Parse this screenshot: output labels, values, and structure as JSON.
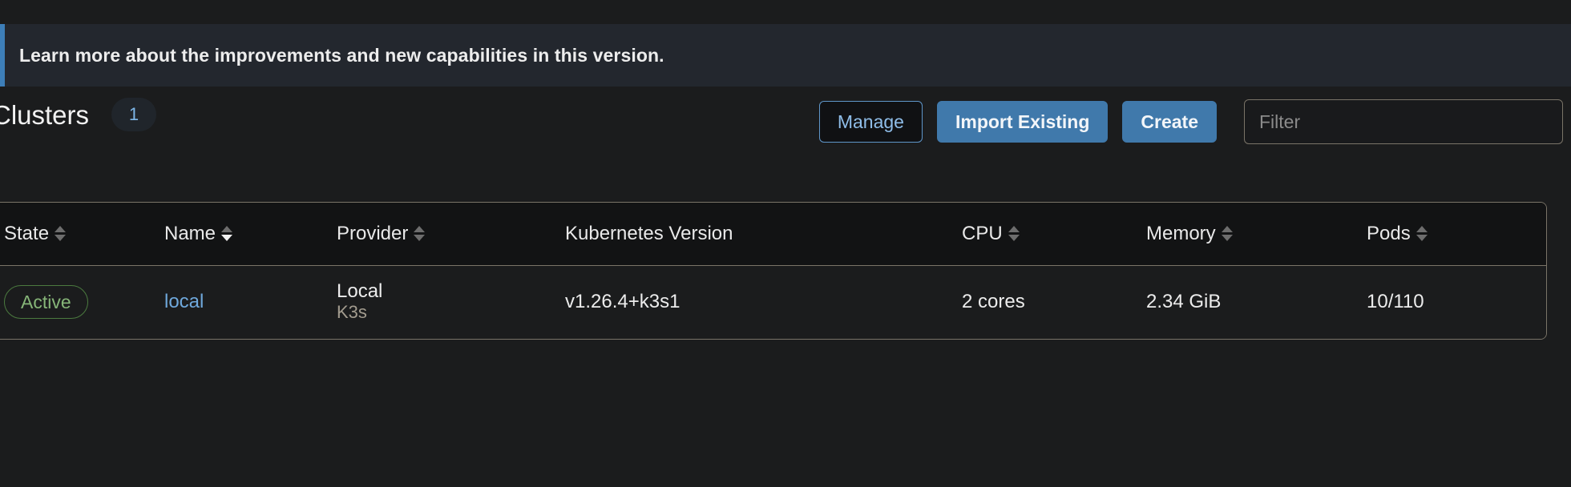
{
  "banner": {
    "message": "Learn more about the improvements and new capabilities in this version.",
    "accent_color": "#3d7eb8",
    "background_color": "#23272e"
  },
  "header": {
    "title": "Clusters",
    "count": "1",
    "buttons": [
      {
        "label": "Manage",
        "style": "outline"
      },
      {
        "label": "Import Existing",
        "style": "primary"
      },
      {
        "label": "Create",
        "style": "primary"
      }
    ],
    "filter": {
      "placeholder": "Filter",
      "value": ""
    }
  },
  "table": {
    "columns": [
      {
        "label": "State",
        "sortable": true,
        "sort_state": "none"
      },
      {
        "label": "Name",
        "sortable": true,
        "sort_state": "asc"
      },
      {
        "label": "Provider",
        "sortable": true,
        "sort_state": "none"
      },
      {
        "label": "Kubernetes Version",
        "sortable": false,
        "sort_state": "none"
      },
      {
        "label": "CPU",
        "sortable": true,
        "sort_state": "none"
      },
      {
        "label": "Memory",
        "sortable": true,
        "sort_state": "none"
      },
      {
        "label": "Pods",
        "sortable": true,
        "sort_state": "none"
      }
    ],
    "rows": [
      {
        "state": "Active",
        "name": "local",
        "provider": "Local",
        "provider_sub": "K3s",
        "kubernetes_version": "v1.26.4+k3s1",
        "cpu": "2 cores",
        "memory": "2.34 GiB",
        "pods": "10/110"
      }
    ]
  },
  "colors": {
    "page_background": "#1b1c1d",
    "table_border": "#7a7468",
    "link": "#6fa8dc",
    "active_badge": "#86b578",
    "primary_button": "#4079ab"
  }
}
